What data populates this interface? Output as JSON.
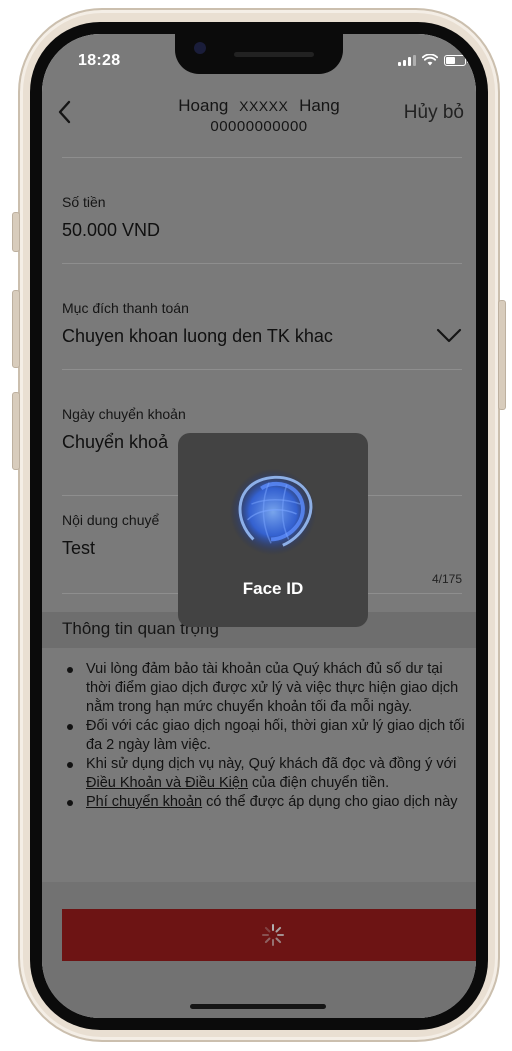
{
  "status_bar": {
    "time": "18:28"
  },
  "header": {
    "recipient_first": "Hoang",
    "recipient_masked": "XXXXX",
    "recipient_last": "Hang",
    "account_number": "00000000000",
    "cancel_label": "Hủy bỏ"
  },
  "form": {
    "amount": {
      "label": "Số tiền",
      "value": "50.000 VND"
    },
    "purpose": {
      "label": "Mục đích thanh toán",
      "value": "Chuyen khoan luong den TK khac"
    },
    "date": {
      "label": "Ngày chuyển khoản",
      "value": "Chuyển khoả"
    },
    "note": {
      "label": "Nội dung chuyể",
      "value": "Test",
      "counter": "4/175"
    }
  },
  "info": {
    "title": "Thông tin quan trọng",
    "item1": "Vui lòng đảm bảo tài khoản của Quý khách đủ số dư tại thời điểm giao dịch được xử lý và việc thực hiện giao dịch nằm trong hạn mức chuyển khoản tối đa mỗi ngày.",
    "item2": "Đối với các giao dịch ngoại hối, thời gian xử lý giao dịch tối đa 2 ngày làm việc.",
    "item3_pre": "Khi sử dụng dịch vụ này, Quý khách đã đọc và đồng ý với ",
    "item3_link": "Điều Khoản và Điều Kiện",
    "item3_post": " của điện chuyển tiền.",
    "item4_link": "Phí chuyển khoản",
    "item4_post": " có thể được áp dụng cho giao dịch này"
  },
  "face_id": {
    "label": "Face ID"
  },
  "colors": {
    "overlay": "#7a7a7a",
    "submit": "#6d1414",
    "faceid_bg": "#434343",
    "faceid_glow": "#2f6bff"
  }
}
